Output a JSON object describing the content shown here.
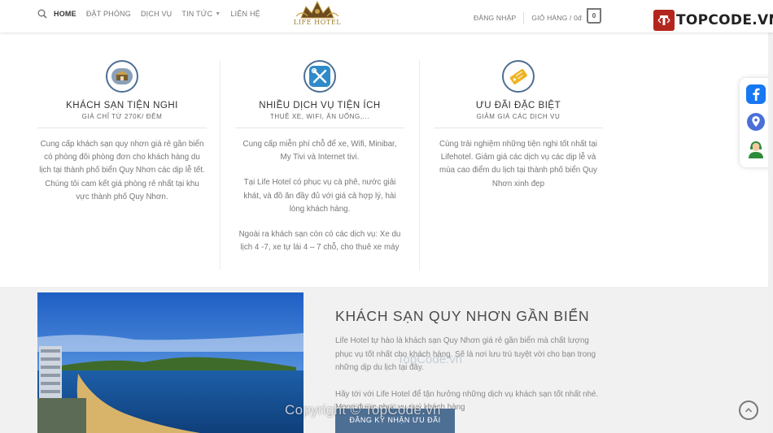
{
  "header": {
    "nav": [
      {
        "label": "HOME",
        "active": true
      },
      {
        "label": "ĐẶT PHÒNG"
      },
      {
        "label": "DỊCH VỤ"
      },
      {
        "label": "TIN TỨC",
        "dropdown": true
      },
      {
        "label": "LIÊN HỆ"
      }
    ],
    "logo_text": "LIFE HOTEL",
    "login": "ĐĂNG NHẬP",
    "cart_label": "GIỎ HÀNG / 0đ",
    "cart_count": "0",
    "brand_name": "TOPCODE.VN"
  },
  "features": [
    {
      "icon": "hotel-icon",
      "title": "KHÁCH SẠN TIỆN NGHI",
      "subtitle": "GIÁ CHỈ TỪ 270K/ ĐÊM",
      "paragraphs": [
        "Cung cấp khách sạn quy nhơn giá rẻ gần biển có phòng đôi phòng đơn cho khách hàng du lịch tại thành phố biển Quy Nhơn các dịp lễ tết. Chúng tôi cam kết giá phòng rẻ nhất tại khu vực thành phố Quy Nhơn."
      ]
    },
    {
      "icon": "tools-icon",
      "title": "NHIỀU DỊCH VỤ TIỆN ÍCH",
      "subtitle": "THUÊ XE, WIFI, ĂN UỐNG,...",
      "paragraphs": [
        "Cung cấp miễn phí chỗ để xe, Wifi, Minibar, My Tivi và Internet tivi.",
        "Tại Life Hotel có phục vụ cà phê, nước giải khát, và đồ ăn đầy đủ với giá cả hợp lý, hài lòng khách hàng.",
        "Ngoài ra khách sạn còn có các dịch vụ: Xe du lịch 4 -7, xe tự lái 4 – 7 chỗ, cho thuê xe máy"
      ]
    },
    {
      "icon": "coupon-icon",
      "title": "ƯU ĐÃI ĐẶC BIỆT",
      "subtitle": "GIẢM GIÁ CÁC DỊCH VỤ",
      "paragraphs": [
        "Cùng trải nghiệm những tiện nghi tốt nhất tại Lifehotel. Giảm giá các dịch vụ các dịp lễ và mùa cao điểm du lịch tại thành phố biển Quy Nhơn xinh đẹp"
      ]
    }
  ],
  "about": {
    "title": "KHÁCH SẠN QUY NHƠN GẦN BIỂN",
    "p1": "Life Hotel tự hào là khách sạn Quy Nhơn giá rẻ gần biển mà chất lượng phục vụ tốt nhất cho khách hàng. Sẽ là nơi lưu trú tuyệt vời cho bạn trong những dịp du lịch tại đây.",
    "p2": "Hãy tới với Life Hotel để tận hưởng những dịch vụ khách sạn tốt nhất nhé. Mong được phục vụ quý khách hàng",
    "cta": "ĐĂNG KÝ NHẬN ƯU ĐÃI"
  },
  "watermark": "Copyright © TopCode.vn",
  "watermark2": "TopCode.vn",
  "colors": {
    "accent": "#4e6f94",
    "brand_red": "#b3261e",
    "facebook": "#1877f2"
  }
}
